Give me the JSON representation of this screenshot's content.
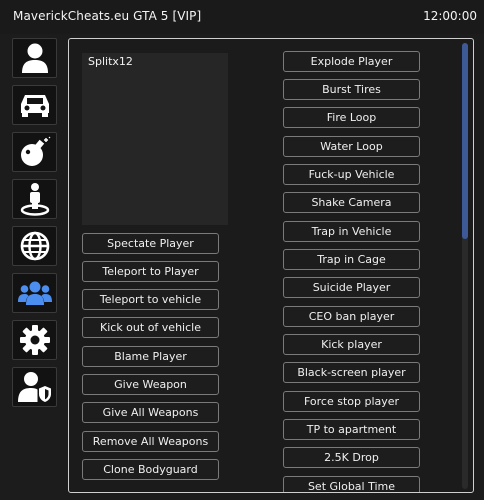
{
  "window": {
    "title": "MaverickCheats.eu GTA 5 [VIP]",
    "clock": "12:00:00"
  },
  "sidebar": {
    "items": [
      {
        "icon": "user-icon",
        "color": "#ffffff"
      },
      {
        "icon": "car-icon",
        "color": "#ffffff"
      },
      {
        "icon": "bomb-icon",
        "color": "#ffffff"
      },
      {
        "icon": "teleport-icon",
        "color": "#ffffff"
      },
      {
        "icon": "globe-icon",
        "color": "#ffffff"
      },
      {
        "icon": "users-icon",
        "color": "#4c8ef0",
        "active": true
      },
      {
        "icon": "gear-icon",
        "color": "#ffffff"
      },
      {
        "icon": "user-shield-icon",
        "color": "#ffffff"
      }
    ]
  },
  "players": [
    "Splitx12"
  ],
  "left_buttons": [
    "Spectate Player",
    "Teleport to Player",
    "Teleport to vehicle",
    "Kick out of vehicle",
    "Blame Player",
    "Give Weapon",
    "Give All Weapons",
    "Remove All Weapons",
    "Clone Bodyguard"
  ],
  "right_buttons": [
    "Explode Player",
    "Burst Tires",
    "Fire Loop",
    "Water Loop",
    "Fuck-up Vehicle",
    "Shake Camera",
    "Trap in Vehicle",
    "Trap in Cage",
    "Suicide Player",
    "CEO ban player",
    "Kick player",
    "Black-screen player",
    "Force stop player",
    "TP to apartment",
    "2.5K Drop",
    "Set Global Time"
  ],
  "colors": {
    "accent": "#4c8ef0",
    "scroll_thumb": "#3e5a96",
    "background": "#1c1c1c"
  }
}
